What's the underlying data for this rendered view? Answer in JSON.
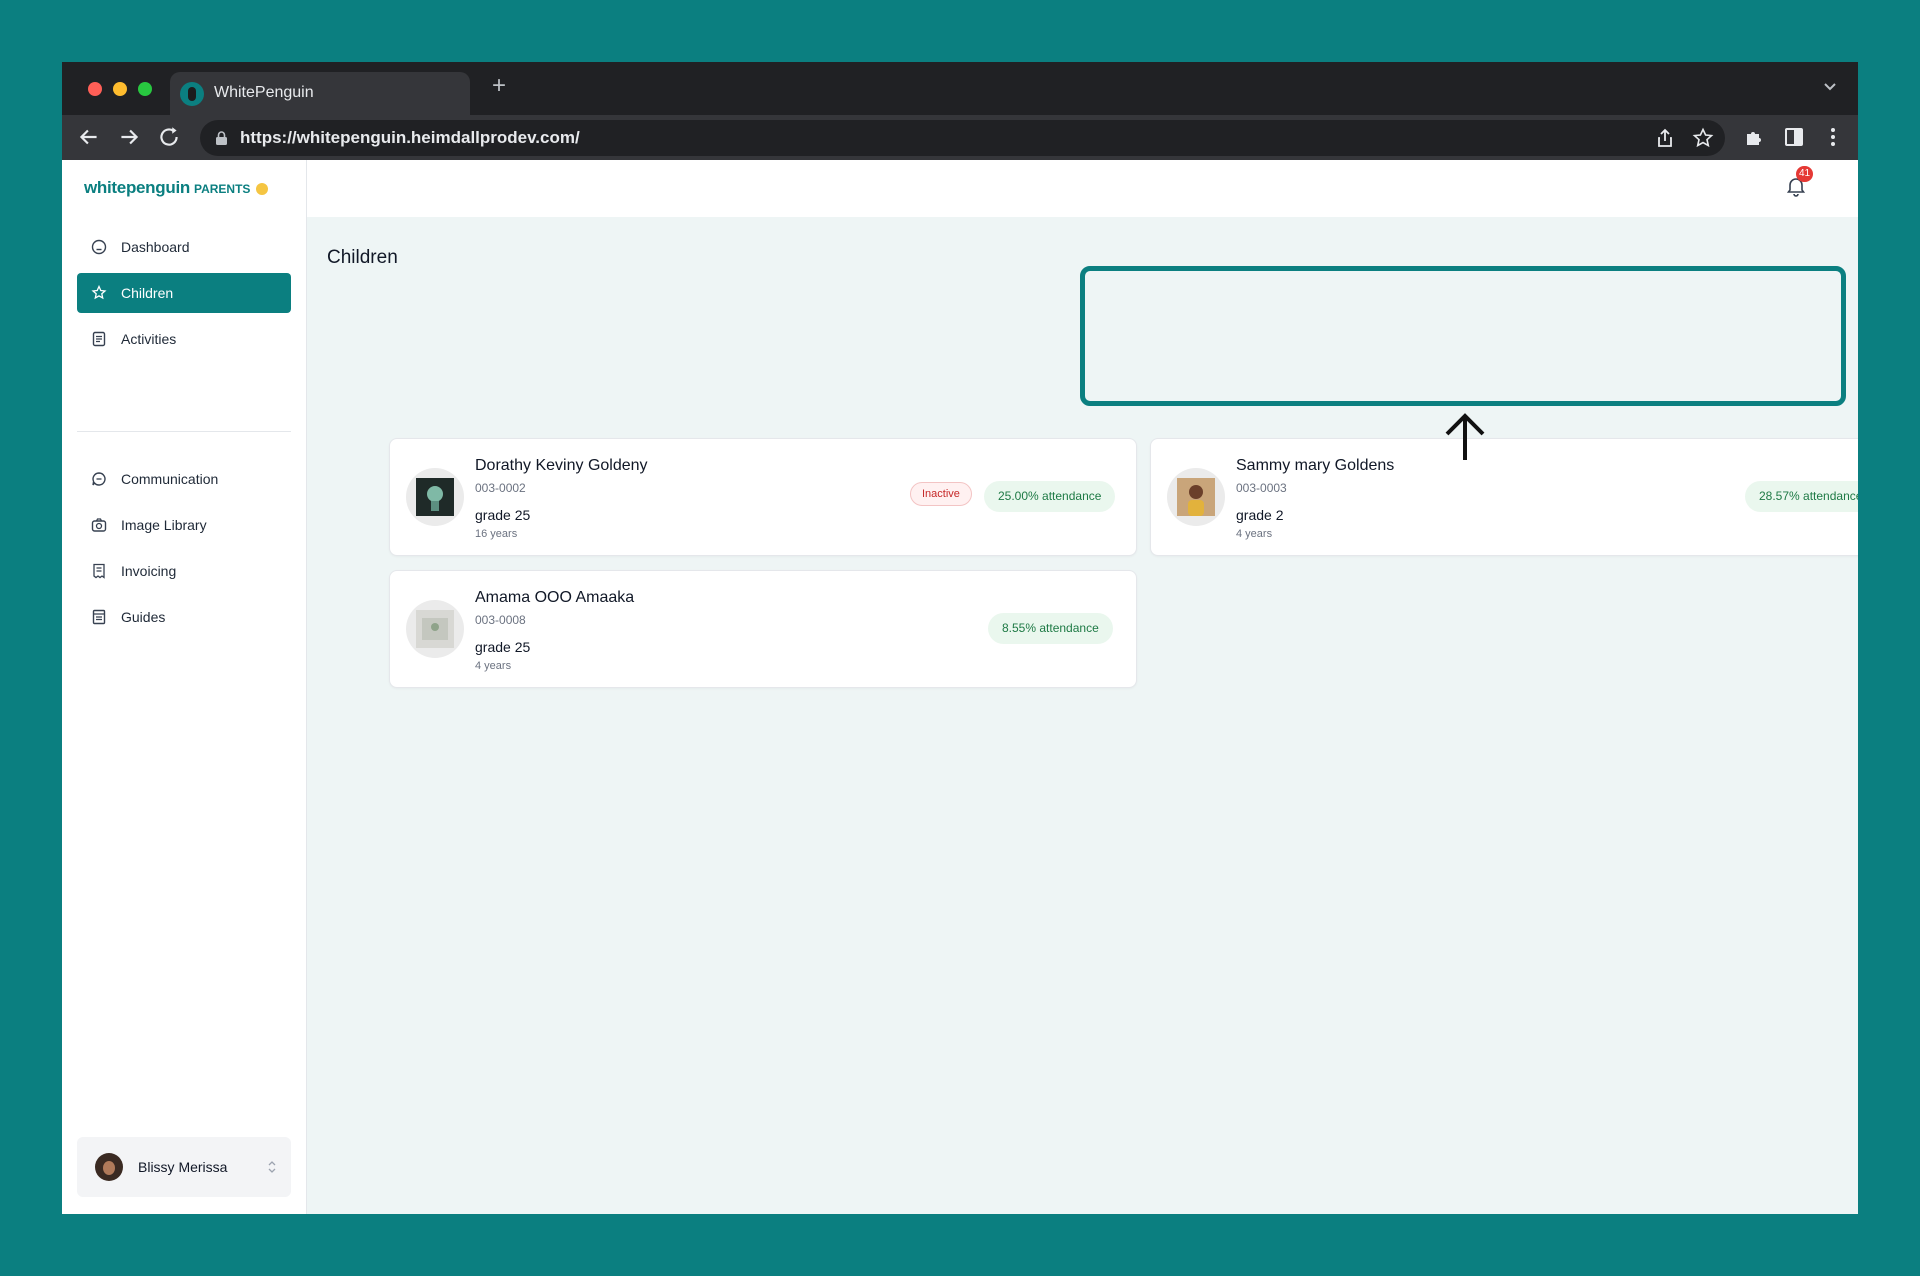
{
  "browser": {
    "tab_title": "WhitePenguin",
    "new_tab_symbol": "+",
    "url": "https://whitepenguin.heimdallprodev.com/"
  },
  "sidebar": {
    "logo_brand": "whitepenguin",
    "logo_suffix": "PARENTS",
    "items": [
      {
        "label": "Dashboard",
        "icon": "dashboard-icon",
        "active": false
      },
      {
        "label": "Children",
        "icon": "children-icon",
        "active": true
      },
      {
        "label": "Activities",
        "icon": "activities-icon",
        "active": false
      },
      {
        "label": "Communication",
        "icon": "chat-icon",
        "active": false
      },
      {
        "label": "Image Library",
        "icon": "camera-icon",
        "active": false
      },
      {
        "label": "Invoicing",
        "icon": "invoice-icon",
        "active": false
      },
      {
        "label": "Guides",
        "icon": "guides-icon",
        "active": false
      }
    ],
    "user_name": "Blissy Merissa"
  },
  "topbar": {
    "notification_count": "41"
  },
  "main": {
    "title": "Children",
    "children": [
      {
        "name": "Dorathy Keviny Goldeny",
        "id": "003-0002",
        "grade": "grade 25",
        "age": "16 years",
        "status": "Inactive",
        "attendance": "25.00% attendance"
      },
      {
        "name": "Sammy mary Goldens",
        "id": "003-0003",
        "grade": "grade 2",
        "age": "4 years",
        "status": "",
        "attendance": "28.57% attendance"
      },
      {
        "name": "Amama OOO Amaaka",
        "id": "003-0008",
        "grade": "grade 25",
        "age": "4 years",
        "status": "",
        "attendance": "8.55% attendance"
      }
    ]
  },
  "colors": {
    "brand": "#0b7f80",
    "attendance_text": "#1e7a45",
    "inactive_text": "#c62828",
    "notification_badge": "#e53935"
  }
}
